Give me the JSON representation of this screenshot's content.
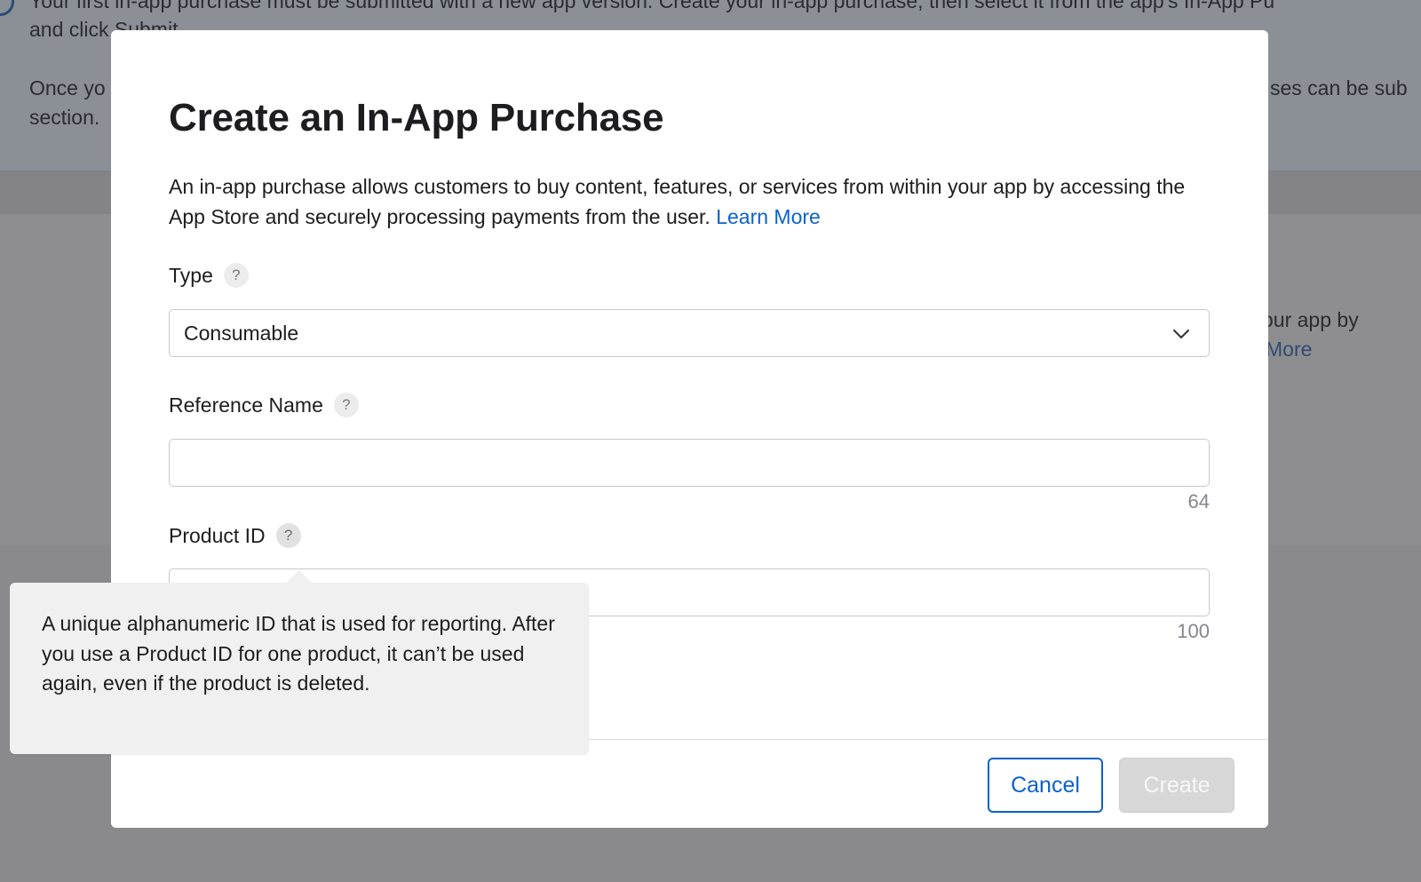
{
  "background": {
    "banner_line1": "Your first in-app purchase must be submitted with a new app version. Create your in-app purchase, then select it from the app's In-App Pu",
    "banner_line2": "and click Submit.",
    "banner_line3_left": "Once yo",
    "banner_line3_right": "ses can be sub",
    "banner_line4": "section.",
    "card_text_1": "our app by",
    "card_link": "More"
  },
  "modal": {
    "title": "Create an In-App Purchase",
    "description": "An in-app purchase allows customers to buy content, features, or services from within your app by accessing the App Store and securely processing payments from the user.",
    "learn_more": "Learn More",
    "type": {
      "label": "Type",
      "help": "?",
      "selected": "Consumable"
    },
    "reference_name": {
      "label": "Reference Name",
      "help": "?",
      "value": "",
      "counter": "64"
    },
    "product_id": {
      "label": "Product ID",
      "help": "?",
      "value": "",
      "counter": "100"
    },
    "footer": {
      "cancel": "Cancel",
      "create": "Create"
    }
  },
  "tooltip": {
    "text": "A unique alphanumeric ID that is used for reporting. After you use a Product ID for one product, it can’t be used again, even if the product is deleted."
  },
  "colors": {
    "link": "#0b62c9",
    "overlay": "#8a8a8c",
    "disabled_button": "#d7d7d8"
  }
}
